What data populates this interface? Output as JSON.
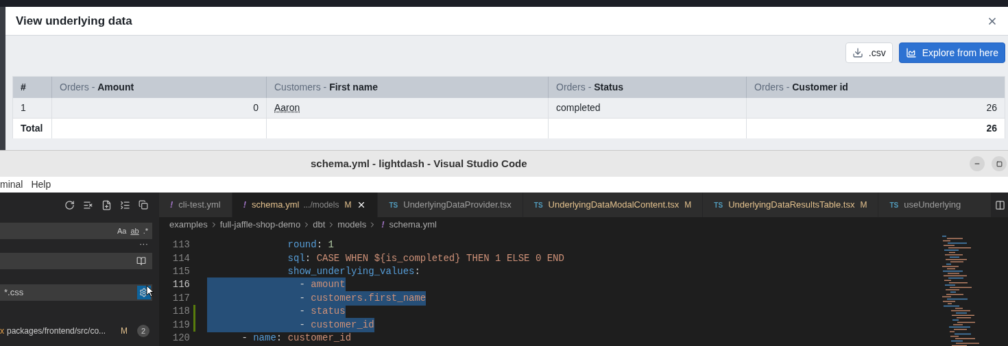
{
  "modal": {
    "title": "View underlying data",
    "buttons": [
      {
        "kind": "download",
        "label": ".csv"
      },
      {
        "kind": "explore",
        "label": "Explore from here"
      }
    ],
    "table": {
      "columns": [
        {
          "name": "#",
          "kind": "text"
        },
        {
          "prefix": "Orders - ",
          "name": "Amount",
          "kind": "number"
        },
        {
          "prefix": "Customers - ",
          "name": "First name",
          "kind": "text"
        },
        {
          "prefix": "Orders - ",
          "name": "Status",
          "kind": "text"
        },
        {
          "prefix": "Orders - ",
          "name": "Customer id",
          "kind": "number"
        }
      ],
      "rows": [
        [
          "1",
          "0",
          "Aaron",
          "completed",
          "26"
        ]
      ],
      "total": {
        "label": "Total",
        "customer_id": "26"
      }
    }
  },
  "vscode": {
    "title": "schema.yml - lightdash - Visual Studio Code",
    "menu": [
      "minal",
      "Help"
    ],
    "sidebar": {
      "search_options": [
        "Aa",
        "ab",
        ".*"
      ],
      "more": "···",
      "include": "*.css",
      "result": {
        "prefix": "x",
        "path": "packages/frontend/src/co...",
        "status": "M",
        "count": "2"
      }
    },
    "tabs": [
      {
        "icon": "!",
        "label": "cli-test.yml",
        "selected": false
      },
      {
        "icon": "!",
        "label": "schema.yml",
        "detail": ".../models",
        "status": "M",
        "selected": true
      },
      {
        "icon": "TS",
        "label": "UnderlyingDataProvider.tsx",
        "selected": false
      },
      {
        "icon": "TS",
        "label": "UnderlyingDataModalContent.tsx",
        "status": "M",
        "selected": false
      },
      {
        "icon": "TS",
        "label": "UnderlyingDataResultsTable.tsx",
        "status": "M",
        "selected": false
      },
      {
        "icon": "TS",
        "label": "useUnderlying",
        "selected": false
      }
    ],
    "breadcrumb": [
      "examples",
      "full-jaffle-shop-demo",
      "dbt",
      "models"
    ],
    "breadcrumb_file": {
      "icon": "!",
      "label": "schema.yml"
    },
    "lines": [
      {
        "number": "113",
        "selected": false,
        "modified": false,
        "tokens": [
          {
            "kind": "key",
            "text": "              round"
          },
          {
            "kind": "punct",
            "text": ": "
          },
          {
            "kind": "number",
            "text": "1"
          }
        ]
      },
      {
        "number": "114",
        "selected": false,
        "modified": false,
        "tokens": [
          {
            "kind": "key",
            "text": "              sql"
          },
          {
            "kind": "punct",
            "text": ": "
          },
          {
            "kind": "string",
            "text": "CASE WHEN ${is_completed} THEN 1 ELSE 0 END"
          }
        ]
      },
      {
        "number": "115",
        "selected": false,
        "modified": false,
        "tokens": [
          {
            "kind": "key",
            "text": "              show_underlying_values"
          },
          {
            "kind": "punct",
            "text": ":"
          }
        ]
      },
      {
        "number": "116",
        "selected": true,
        "modified": false,
        "tokens": [
          {
            "kind": "punct",
            "text": "                - "
          },
          {
            "kind": "string",
            "text": "amount"
          }
        ]
      },
      {
        "number": "117",
        "selected": true,
        "modified": false,
        "tokens": [
          {
            "kind": "punct",
            "text": "                - "
          },
          {
            "kind": "string",
            "text": "customers.first_name"
          }
        ]
      },
      {
        "number": "118",
        "selected": true,
        "modified": true,
        "tokens": [
          {
            "kind": "punct",
            "text": "                - "
          },
          {
            "kind": "string",
            "text": "status"
          }
        ]
      },
      {
        "number": "119",
        "selected": true,
        "modified": true,
        "tokens": [
          {
            "kind": "punct",
            "text": "                - "
          },
          {
            "kind": "string",
            "text": "customer_id"
          }
        ]
      },
      {
        "number": "120",
        "selected": false,
        "modified": false,
        "tokens": [
          {
            "kind": "punct",
            "text": "      - "
          },
          {
            "kind": "key",
            "text": "name"
          },
          {
            "kind": "punct",
            "text": ": "
          },
          {
            "kind": "string",
            "text": "customer_id"
          }
        ]
      }
    ]
  }
}
